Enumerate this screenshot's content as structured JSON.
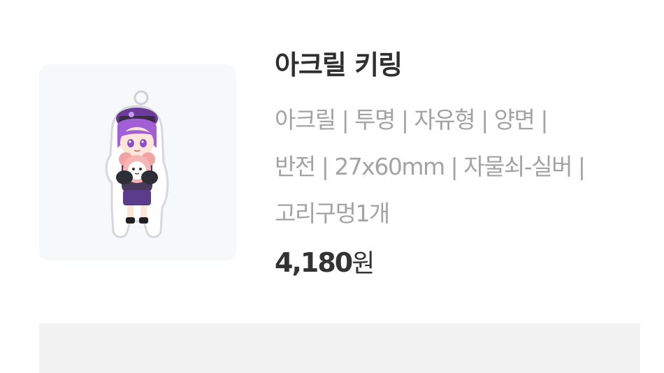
{
  "product": {
    "title": "아크릴 키링",
    "desc_lines": [
      "아크릴 | 투명 | 자유형 | 양면 |",
      "반전 | 27x60mm | 자물쇠-실버 |",
      "고리구멍1개"
    ],
    "price_amount": "4,180",
    "price_unit": "원"
  },
  "colors": {
    "title": "#2f2f2f",
    "description": "#a3a3a3",
    "price": "#333333",
    "thumbnail_bg": "#f7f8fa",
    "bottom_panel_bg": "#f2f2f2",
    "character_hair": "#a35fd6"
  }
}
